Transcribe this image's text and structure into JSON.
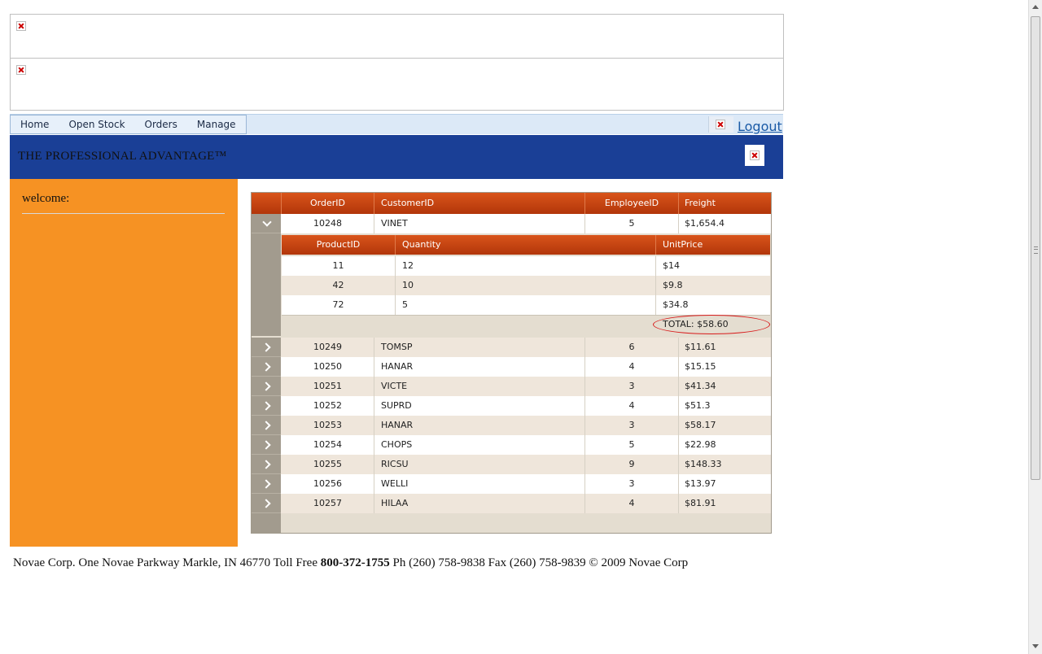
{
  "menu": {
    "items": [
      {
        "label": "Home"
      },
      {
        "label": "Open Stock"
      },
      {
        "label": "Orders"
      },
      {
        "label": "Manage"
      }
    ],
    "logout": "Logout"
  },
  "header": {
    "brand": "THE PROFESSIONAL ADVANTAGE™",
    "colors": {
      "header": "#1a3f96",
      "sidebar": "#f69223",
      "grid_header": "#c4410f"
    }
  },
  "sidebar": {
    "welcome": "welcome:"
  },
  "grid": {
    "columns": [
      "OrderID",
      "CustomerID",
      "EmployeeID",
      "Freight"
    ],
    "expanded_row": {
      "order_id": "10248",
      "customer_id": "VINET",
      "employee_id": "5",
      "freight": "$1,654.4"
    },
    "detail": {
      "columns": [
        "ProductID",
        "Quantity",
        "UnitPrice"
      ],
      "rows": [
        {
          "product_id": "11",
          "quantity": "12",
          "unit_price": "$14"
        },
        {
          "product_id": "42",
          "quantity": "10",
          "unit_price": "$9.8"
        },
        {
          "product_id": "72",
          "quantity": "5",
          "unit_price": "$34.8"
        }
      ],
      "total": "TOTAL: $58.60"
    },
    "rows": [
      {
        "order_id": "10249",
        "customer_id": "TOMSP",
        "employee_id": "6",
        "freight": "$11.61"
      },
      {
        "order_id": "10250",
        "customer_id": "HANAR",
        "employee_id": "4",
        "freight": "$15.15"
      },
      {
        "order_id": "10251",
        "customer_id": "VICTE",
        "employee_id": "3",
        "freight": "$41.34"
      },
      {
        "order_id": "10252",
        "customer_id": "SUPRD",
        "employee_id": "4",
        "freight": "$51.3"
      },
      {
        "order_id": "10253",
        "customer_id": "HANAR",
        "employee_id": "3",
        "freight": "$58.17"
      },
      {
        "order_id": "10254",
        "customer_id": "CHOPS",
        "employee_id": "5",
        "freight": "$22.98"
      },
      {
        "order_id": "10255",
        "customer_id": "RICSU",
        "employee_id": "9",
        "freight": "$148.33"
      },
      {
        "order_id": "10256",
        "customer_id": "WELLI",
        "employee_id": "3",
        "freight": "$13.97"
      },
      {
        "order_id": "10257",
        "customer_id": "HILAA",
        "employee_id": "4",
        "freight": "$81.91"
      }
    ]
  },
  "footer": {
    "prefix": "Novae Corp. One Novae Parkway Markle, IN 46770 Toll Free ",
    "phone_bold": "800-372-1755",
    "suffix": " Ph (260) 758-9838 Fax (260) 758-9839 © 2009 Novae Corp"
  }
}
